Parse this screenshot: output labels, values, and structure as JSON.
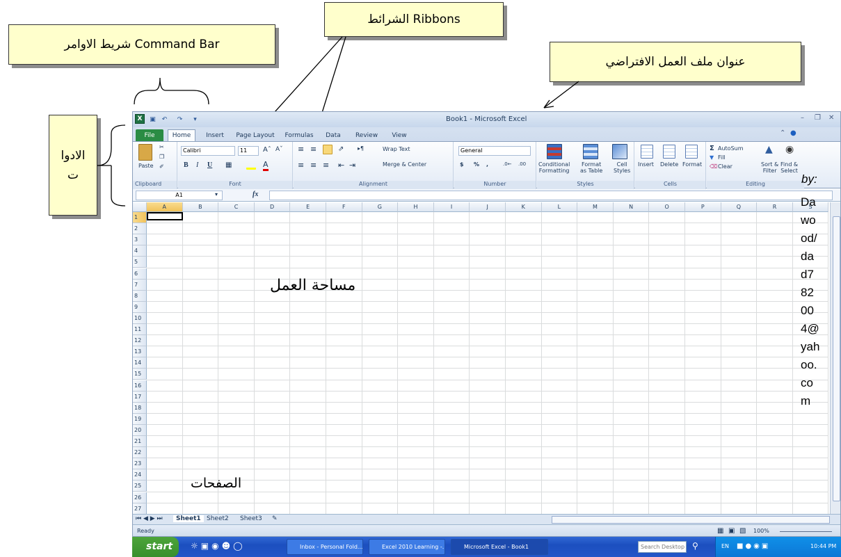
{
  "annotations": {
    "command_bar": "شريط الاوامر  Command Bar",
    "ribbons": "الشرائط  Ribbons",
    "workbook_title": "عنوان ملف العمل الافتراضي",
    "tools": "الادوا\nت",
    "work_area": "مساحة العمل",
    "sheets": "الصفحات",
    "by_label": "by:",
    "author_email": [
      "Da",
      "wo",
      "od/",
      "da",
      "d7",
      "82",
      "00",
      "4@",
      "yah",
      "oo.",
      "co",
      "m"
    ]
  },
  "window": {
    "title": "Book1 - Microsoft Excel"
  },
  "tabs": [
    "File",
    "Home",
    "Insert",
    "Page Layout",
    "Formulas",
    "Data",
    "Review",
    "View"
  ],
  "ribbon": {
    "clipboard": {
      "paste": "Paste",
      "label": "Clipboard"
    },
    "font": {
      "name": "Calibri",
      "size": "11",
      "label": "Font"
    },
    "alignment": {
      "wrap": "Wrap Text",
      "merge": "Merge & Center",
      "label": "Alignment"
    },
    "number": {
      "format": "General",
      "label": "Number"
    },
    "styles": {
      "conditional": "Conditional\nFormatting",
      "format_table": "Format\nas Table",
      "cell_styles": "Cell\nStyles",
      "label": "Styles"
    },
    "cells": {
      "insert": "Insert",
      "delete": "Delete",
      "format": "Format",
      "label": "Cells"
    },
    "editing": {
      "autosum": "AutoSum",
      "fill": "Fill",
      "clear": "Clear",
      "sort": "Sort &\nFilter",
      "find": "Find &\nSelect",
      "label": "Editing"
    }
  },
  "formula_bar": {
    "name_box": "A1",
    "fx": "fx"
  },
  "columns": [
    "A",
    "B",
    "C",
    "D",
    "E",
    "F",
    "G",
    "H",
    "I",
    "J",
    "K",
    "L",
    "M",
    "N",
    "O",
    "P",
    "Q",
    "R",
    "S"
  ],
  "rows": [
    "1",
    "2",
    "3",
    "4",
    "5",
    "6",
    "7",
    "8",
    "9",
    "10",
    "11",
    "12",
    "13",
    "14",
    "15",
    "16",
    "17",
    "18",
    "19",
    "20",
    "21",
    "22",
    "23",
    "24",
    "25",
    "26",
    "27"
  ],
  "sheets": [
    "Sheet1",
    "Sheet2",
    "Sheet3"
  ],
  "status": {
    "ready": "Ready",
    "zoom": "100%"
  },
  "taskbar": {
    "start": "start",
    "items": [
      "Inbox - Personal Fold...",
      "Excel 2010 Learning -...",
      "Microsoft Excel - Book1"
    ],
    "search": "Search Desktop",
    "lang": "EN",
    "time": "10:44 PM"
  }
}
